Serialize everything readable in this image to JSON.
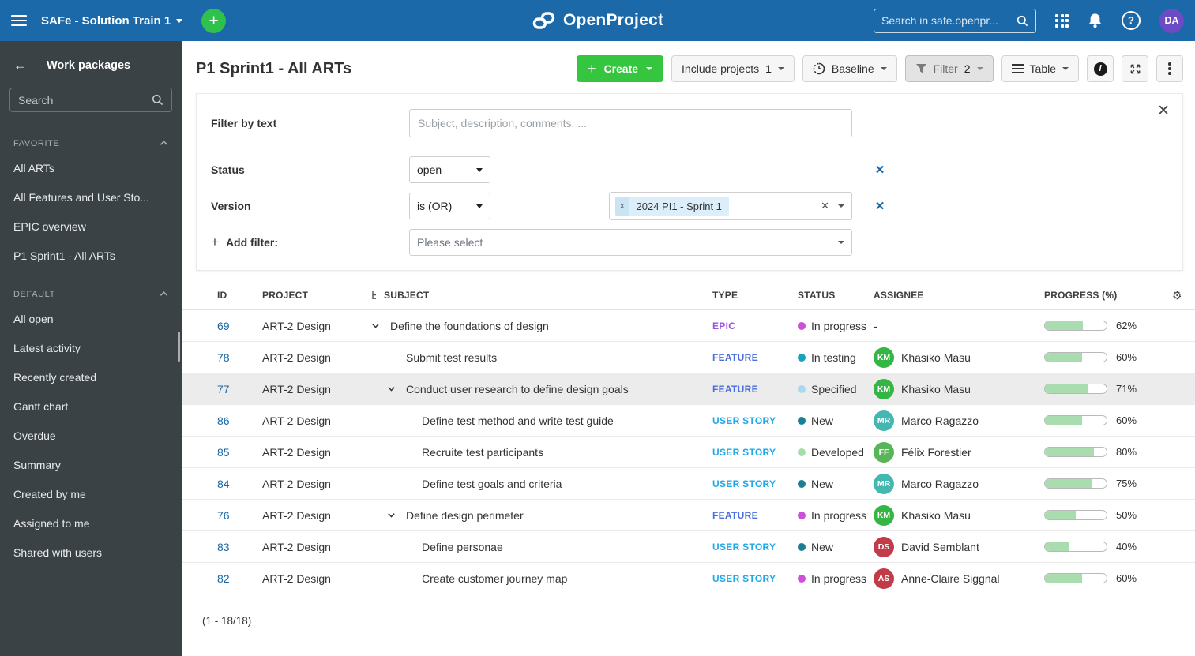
{
  "topbar": {
    "project_selector": "SAFe - Solution Train 1",
    "logo_text": "OpenProject",
    "search_placeholder": "Search in safe.openpr...",
    "avatar_initials": "DA"
  },
  "sidebar": {
    "title": "Work packages",
    "search_placeholder": "Search",
    "groups": [
      {
        "label": "FAVORITE",
        "items": [
          "All ARTs",
          "All Features and User Sto...",
          "EPIC overview",
          "P1 Sprint1 - All ARTs"
        ]
      },
      {
        "label": "DEFAULT",
        "items": [
          "All open",
          "Latest activity",
          "Recently created",
          "Gantt chart",
          "Overdue",
          "Summary",
          "Created by me",
          "Assigned to me",
          "Shared with users"
        ]
      }
    ]
  },
  "toolbar": {
    "title": "P1 Sprint1 - All ARTs",
    "create_label": "Create",
    "include_projects_label": "Include projects",
    "include_projects_count": "1",
    "baseline_label": "Baseline",
    "filter_label": "Filter",
    "filter_count": "2",
    "table_label": "Table"
  },
  "filters": {
    "text_label": "Filter by text",
    "text_placeholder": "Subject, description, comments, ...",
    "rows": [
      {
        "name": "Status",
        "operator": "open"
      },
      {
        "name": "Version",
        "operator": "is (OR)",
        "values": [
          "2024 PI1 - Sprint 1"
        ]
      }
    ],
    "add_filter_label": "Add filter:",
    "add_filter_placeholder": "Please select"
  },
  "table": {
    "columns": [
      "ID",
      "PROJECT",
      "SUBJECT",
      "TYPE",
      "STATUS",
      "ASSIGNEE",
      "PROGRESS (%)"
    ],
    "rows": [
      {
        "id": "69",
        "project": "ART-2 Design",
        "subject": "Define the foundations of design",
        "depth": 0,
        "expandable": true,
        "type": "EPIC",
        "type_color": "#9b51e0",
        "status": "In progress",
        "status_color": "#ce4fd8",
        "assignee": "-",
        "initials": "",
        "avatar_color": "",
        "progress": 62,
        "hover": false
      },
      {
        "id": "78",
        "project": "ART-2 Design",
        "subject": "Submit test results",
        "depth": 1,
        "expandable": false,
        "type": "FEATURE",
        "type_color": "#4a6fdc",
        "status": "In testing",
        "status_color": "#17a3bd",
        "assignee": "Khasiko Masu",
        "initials": "KM",
        "avatar_color": "#35b543",
        "progress": 60,
        "hover": false
      },
      {
        "id": "77",
        "project": "ART-2 Design",
        "subject": "Conduct user research to define design goals",
        "depth": 1,
        "expandable": true,
        "type": "FEATURE",
        "type_color": "#4a6fdc",
        "status": "Specified",
        "status_color": "#a8d8f0",
        "assignee": "Khasiko Masu",
        "initials": "KM",
        "avatar_color": "#35b543",
        "progress": 71,
        "hover": true
      },
      {
        "id": "86",
        "project": "ART-2 Design",
        "subject": "Define test method and write test guide",
        "depth": 2,
        "expandable": false,
        "type": "USER STORY",
        "type_color": "#1fa9e8",
        "status": "New",
        "status_color": "#1a7f94",
        "assignee": "Marco Ragazzo",
        "initials": "MR",
        "avatar_color": "#44b8b0",
        "progress": 60,
        "hover": false
      },
      {
        "id": "85",
        "project": "ART-2 Design",
        "subject": "Recruite test participants",
        "depth": 2,
        "expandable": false,
        "type": "USER STORY",
        "type_color": "#1fa9e8",
        "status": "Developed",
        "status_color": "#a5dca8",
        "assignee": "Félix Forestier",
        "initials": "FF",
        "avatar_color": "#58b558",
        "progress": 80,
        "hover": false
      },
      {
        "id": "84",
        "project": "ART-2 Design",
        "subject": "Define test goals and criteria",
        "depth": 2,
        "expandable": false,
        "type": "USER STORY",
        "type_color": "#1fa9e8",
        "status": "New",
        "status_color": "#1a7f94",
        "assignee": "Marco Ragazzo",
        "initials": "MR",
        "avatar_color": "#44b8b0",
        "progress": 75,
        "hover": false
      },
      {
        "id": "76",
        "project": "ART-2 Design",
        "subject": "Define design perimeter",
        "depth": 1,
        "expandable": true,
        "type": "FEATURE",
        "type_color": "#4a6fdc",
        "status": "In progress",
        "status_color": "#ce4fd8",
        "assignee": "Khasiko Masu",
        "initials": "KM",
        "avatar_color": "#35b543",
        "progress": 50,
        "hover": false
      },
      {
        "id": "83",
        "project": "ART-2 Design",
        "subject": "Define personae",
        "depth": 2,
        "expandable": false,
        "type": "USER STORY",
        "type_color": "#1fa9e8",
        "status": "New",
        "status_color": "#1a7f94",
        "assignee": "David Semblant",
        "initials": "DS",
        "avatar_color": "#c23b49",
        "progress": 40,
        "hover": false
      },
      {
        "id": "82",
        "project": "ART-2 Design",
        "subject": "Create customer journey map",
        "depth": 2,
        "expandable": false,
        "type": "USER STORY",
        "type_color": "#1fa9e8",
        "status": "In progress",
        "status_color": "#ce4fd8",
        "assignee": "Anne-Claire Siggnal",
        "initials": "AS",
        "avatar_color": "#c23b49",
        "progress": 60,
        "hover": false
      }
    ],
    "footer": "(1 - 18/18)"
  },
  "colors": {
    "topbar": "#1c69a9",
    "sidebar": "#3b4245",
    "accent_link": "#1a67a3",
    "create_green": "#35c53f",
    "progress_fill": "#a9dcae"
  }
}
